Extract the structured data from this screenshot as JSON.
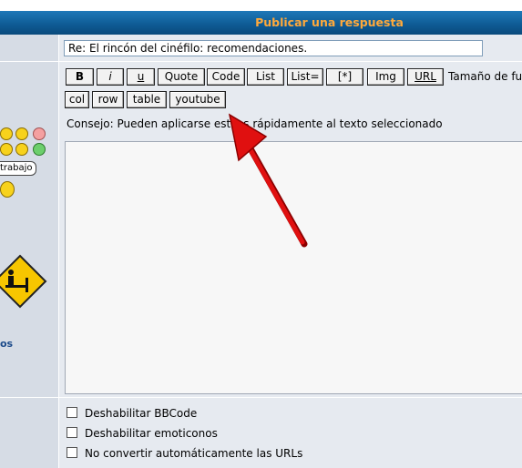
{
  "header": {
    "title": "Publicar una respuesta"
  },
  "subject": {
    "value": "Re: El rincón del cinéfilo: recomendaciones."
  },
  "toolbar": {
    "row1": [
      "B",
      "i",
      "u",
      "Quote",
      "Code",
      "List",
      "List=",
      "[*]",
      "Img",
      "URL"
    ],
    "row2": [
      "col",
      "row",
      "table",
      "youtube"
    ],
    "font_size_label": "Tamaño de fu"
  },
  "tip": "Consejo: Pueden aplicarse estilos rápidamente al texto seleccionado",
  "sidebar": {
    "emoticon_bubble": "trabajo",
    "more_link": "os",
    "icons": [
      "emoticon-smile-icon",
      "emoticon-grin-icon",
      "emoticon-sad-icon",
      "emoticon-arrow-icon",
      "emoticon-neutral-icon",
      "emoticon-green-icon",
      "worker-sign-icon"
    ]
  },
  "options": [
    {
      "label": "Deshabilitar BBCode",
      "checked": false
    },
    {
      "label": "Deshabilitar emoticonos",
      "checked": false
    },
    {
      "label": "No convertir automáticamente las URLs",
      "checked": false
    }
  ],
  "colors": {
    "header_text": "#ffa93b",
    "header_bg": "#0e5a93",
    "arrow": "#e01010"
  }
}
